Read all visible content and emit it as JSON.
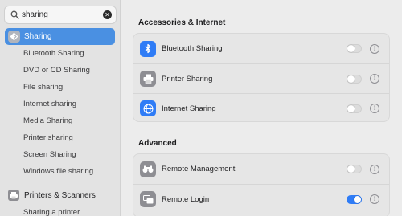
{
  "search": {
    "value": "sharing",
    "placeholder": "Search"
  },
  "sidebar": {
    "selected": "Sharing",
    "results": [
      "Bluetooth Sharing",
      "DVD or CD Sharing",
      "File sharing",
      "Internet sharing",
      "Media Sharing",
      "Printer sharing",
      "Screen Sharing",
      "Windows file sharing"
    ],
    "group2": {
      "label": "Printers & Scanners",
      "results": [
        "Sharing a printer"
      ]
    }
  },
  "main": {
    "sections": [
      {
        "title": "Accessories & Internet",
        "rows": [
          {
            "label": "Bluetooth Sharing",
            "icon": "bluetooth-icon",
            "icon_color": "#2f7cf6",
            "on": false
          },
          {
            "label": "Printer Sharing",
            "icon": "printer-icon",
            "icon_color": "#8e8e93",
            "on": false
          },
          {
            "label": "Internet Sharing",
            "icon": "globe-icon",
            "icon_color": "#2f7cf6",
            "on": false
          }
        ]
      },
      {
        "title": "Advanced",
        "rows": [
          {
            "label": "Remote Management",
            "icon": "binoculars-icon",
            "icon_color": "#8e8e93",
            "on": false
          },
          {
            "label": "Remote Login",
            "icon": "terminal-window-icon",
            "icon_color": "#8e8e93",
            "on": true
          }
        ]
      }
    ]
  },
  "colors": {
    "accent": "#2f7cf6",
    "sidebar_selected": "#4a90e2"
  }
}
